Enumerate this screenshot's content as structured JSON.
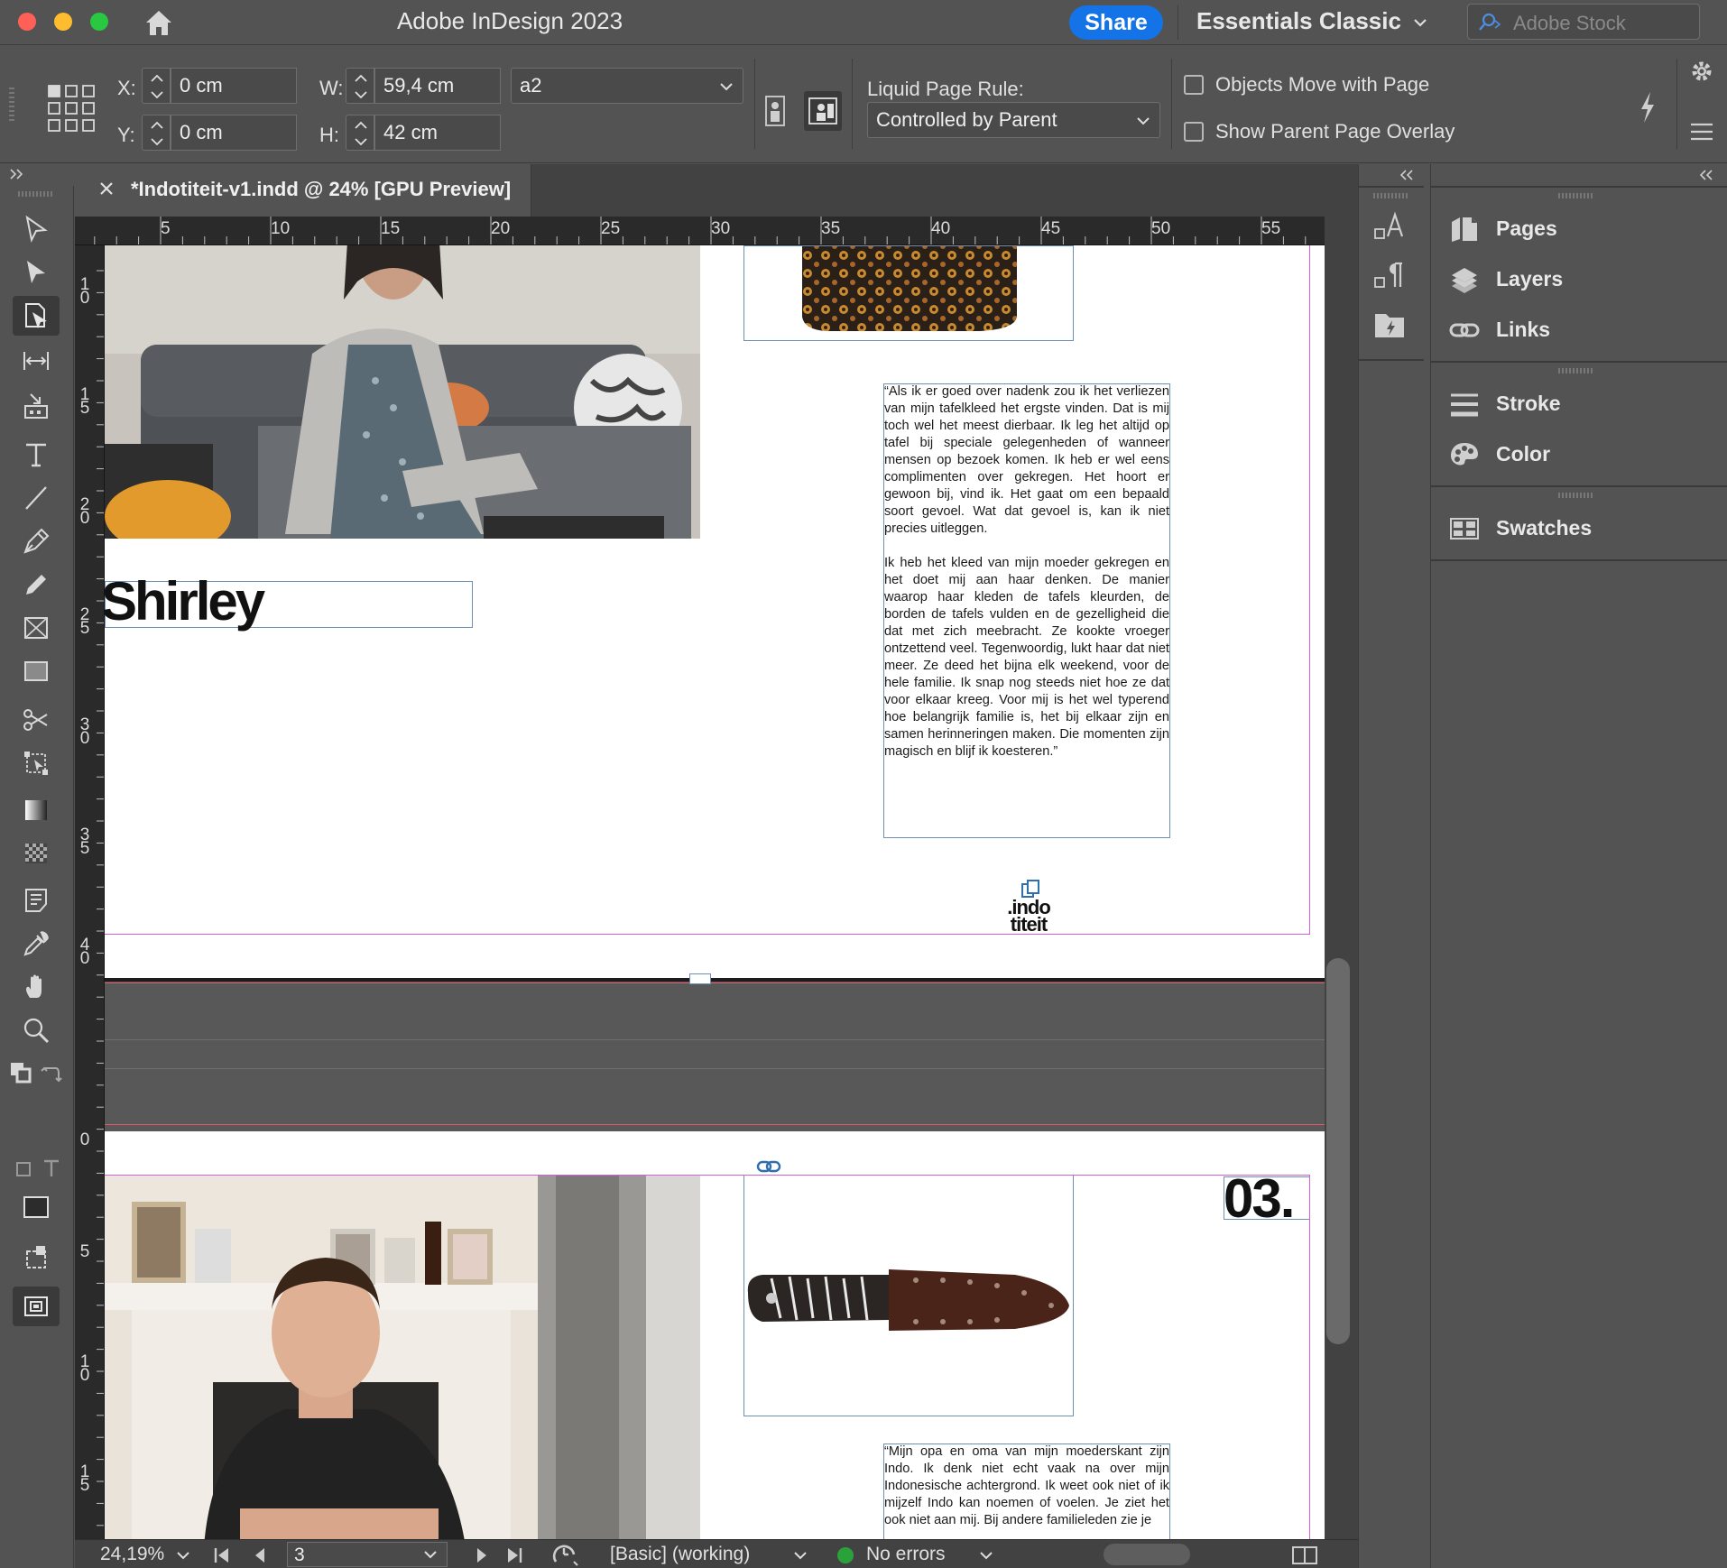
{
  "window": {
    "app_title": "Adobe InDesign 2023",
    "share_label": "Share",
    "workspace": "Essentials Classic",
    "stock_placeholder": "Adobe Stock"
  },
  "control_bar": {
    "x_label": "X:",
    "x_value": "0 cm",
    "y_label": "Y:",
    "y_value": "0 cm",
    "w_label": "W:",
    "w_value": "59,4 cm",
    "h_label": "H:",
    "h_value": "42 cm",
    "page_size": "a2",
    "liquid_rule_label": "Liquid Page Rule:",
    "liquid_rule_value": "Controlled by Parent",
    "objects_move_label": "Objects Move with Page",
    "show_overlay_label": "Show Parent Page Overlay"
  },
  "document": {
    "tab_title": "*Indotiteit-v1.indd @ 24% [GPU Preview]",
    "ruler_h_labels": [
      "5",
      "10",
      "15",
      "20",
      "25",
      "30",
      "35",
      "40",
      "45",
      "50",
      "55"
    ],
    "ruler_v_labels_top": [
      "1 0",
      "1 5",
      "2 0",
      "2 5",
      "3 0",
      "3 5",
      "4 0"
    ],
    "ruler_v_labels_bottom": [
      "0",
      "5",
      "1 0",
      "1 5"
    ],
    "page1": {
      "heading": "Shirley",
      "quote": "“Als ik er goed over nadenk zou ik het verliezen van mijn tafelkleed het ergste vinden. Dat is mij toch wel het meest dierbaar. Ik leg het altijd op tafel bij speciale gelegenheden of wanneer mensen op bezoek komen. Ik heb er wel eens complimenten over gekregen. Het hoort er gewoon bij, vind ik. Het gaat om een bepaald soort gevoel. Wat dat gevoel is, kan ik niet precies uitleggen.\n\nIk heb het kleed van mijn moeder gekregen en het doet mij aan haar denken. De manier waarop haar kleden de tafels kleurden, de borden de tafels vulden en de gezelligheid die dat met zich meebracht. Ze kookte vroeger ontzettend veel. Tegenwoordig, lukt haar dat niet meer. Ze deed het bijna elk weekend, voor de hele familie. Ik snap nog steeds niet hoe ze dat voor elkaar kreeg. Voor mij is het wel typerend hoe belangrijk familie is, het bij elkaar zijn en samen herinneringen maken. Die momenten zijn magisch en blijf ik koesteren.”",
      "logo_line1": ".indo",
      "logo_line2": "titeit"
    },
    "page2": {
      "number": "03.",
      "quote": "“Mijn opa en oma van mijn moederskant zijn Indo. Ik denk niet echt vaak na over mijn Indonesische achtergrond. Ik weet ook niet of ik mijzelf Indo kan noemen of voelen. Je ziet het ook niet aan mij. Bij andere familieleden zie je"
    }
  },
  "status_bar": {
    "zoom": "24,19%",
    "page_number": "3",
    "preflight_profile": "[Basic] (working)",
    "errors": "No errors"
  },
  "panels": {
    "items": [
      "Pages",
      "Layers",
      "Links",
      "Stroke",
      "Color",
      "Swatches"
    ]
  },
  "colors": {
    "accent": "#1473e6",
    "margin_guide": "#d25fd5",
    "frame_edge": "#6f8fb4",
    "ok": "#2aa23a"
  }
}
